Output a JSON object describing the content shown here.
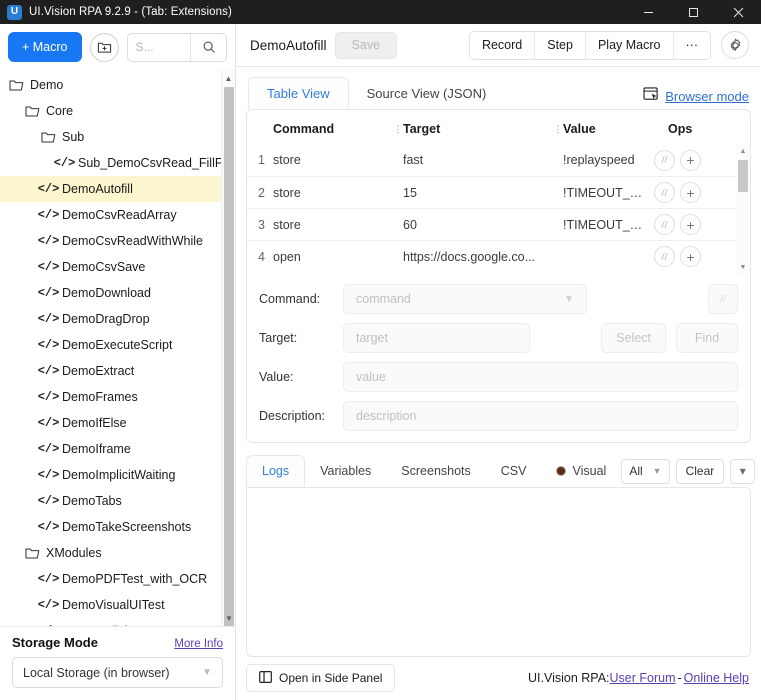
{
  "window": {
    "title": "UI.Vision RPA 9.2.9 - (Tab: Extensions)",
    "logo_letter": "U",
    "minimize_icon": "minimize-icon",
    "maximize_icon": "maximize-icon",
    "close_icon": "close-icon"
  },
  "sidebar": {
    "new_macro_label": "+ Macro",
    "new_folder_icon": "new-folder-icon",
    "search": {
      "value": "",
      "placeholder": "S..."
    },
    "search_icon": "search-icon",
    "tree": [
      {
        "label": "Demo",
        "type": "folder",
        "depth": 0,
        "selected": false
      },
      {
        "label": "Core",
        "type": "folder",
        "depth": 1,
        "selected": false
      },
      {
        "label": "Sub",
        "type": "folder",
        "depth": 2,
        "selected": false
      },
      {
        "label": "Sub_DemoCsvRead_FillFor",
        "type": "macro",
        "depth": 3,
        "selected": false
      },
      {
        "label": "DemoAutofill",
        "type": "macro",
        "depth": 2,
        "selected": true
      },
      {
        "label": "DemoCsvReadArray",
        "type": "macro",
        "depth": 2,
        "selected": false
      },
      {
        "label": "DemoCsvReadWithWhile",
        "type": "macro",
        "depth": 2,
        "selected": false
      },
      {
        "label": "DemoCsvSave",
        "type": "macro",
        "depth": 2,
        "selected": false
      },
      {
        "label": "DemoDownload",
        "type": "macro",
        "depth": 2,
        "selected": false
      },
      {
        "label": "DemoDragDrop",
        "type": "macro",
        "depth": 2,
        "selected": false
      },
      {
        "label": "DemoExecuteScript",
        "type": "macro",
        "depth": 2,
        "selected": false
      },
      {
        "label": "DemoExtract",
        "type": "macro",
        "depth": 2,
        "selected": false
      },
      {
        "label": "DemoFrames",
        "type": "macro",
        "depth": 2,
        "selected": false
      },
      {
        "label": "DemoIfElse",
        "type": "macro",
        "depth": 2,
        "selected": false
      },
      {
        "label": "DemoIframe",
        "type": "macro",
        "depth": 2,
        "selected": false
      },
      {
        "label": "DemoImplicitWaiting",
        "type": "macro",
        "depth": 2,
        "selected": false
      },
      {
        "label": "DemoTabs",
        "type": "macro",
        "depth": 2,
        "selected": false
      },
      {
        "label": "DemoTakeScreenshots",
        "type": "macro",
        "depth": 2,
        "selected": false
      },
      {
        "label": "XModules",
        "type": "folder",
        "depth": 1,
        "selected": false
      },
      {
        "label": "DemoPDFTest_with_OCR",
        "type": "macro",
        "depth": 2,
        "selected": false
      },
      {
        "label": "DemoVisualUITest",
        "type": "macro",
        "depth": 2,
        "selected": false
      },
      {
        "label": "DemoXClick",
        "type": "macro",
        "depth": 2,
        "selected": false
      }
    ],
    "storage": {
      "title": "Storage Mode",
      "more_info_label": "More Info",
      "selected": "Local Storage (in browser)"
    }
  },
  "toolbar": {
    "macro_name": "DemoAutofill",
    "save_label": "Save",
    "record_label": "Record",
    "step_label": "Step",
    "play_macro_label": "Play Macro",
    "more_label": "···",
    "gear_icon": "gear-icon"
  },
  "view_tabs": {
    "items": [
      {
        "label": "Table View",
        "active": true
      },
      {
        "label": "Source View (JSON)",
        "active": false
      }
    ],
    "browser_mode_label": "Browser mode",
    "browser_mode_icon": "browser-window-cursor-icon"
  },
  "table": {
    "columns": [
      "Command",
      "Target",
      "Value",
      "Ops"
    ],
    "rows": [
      {
        "index": "1",
        "command": "store",
        "target": "fast",
        "value": "!replayspeed"
      },
      {
        "index": "2",
        "command": "store",
        "target": "15",
        "value": "!TIMEOUT_WAIT"
      },
      {
        "index": "3",
        "command": "store",
        "target": "60",
        "value": "!TIMEOUT_PAGE..."
      },
      {
        "index": "4",
        "command": "open",
        "target": "https://docs.google.co...",
        "value": ""
      }
    ],
    "op_comment_label": "//",
    "op_add_label": "+"
  },
  "editor": {
    "command_label": "Command:",
    "command_placeholder": "command",
    "command_value": "",
    "target_label": "Target:",
    "target_placeholder": "target",
    "target_value": "",
    "value_label": "Value:",
    "value_placeholder": "value",
    "value_value": "",
    "description_label": "Description:",
    "description_placeholder": "description",
    "description_value": "",
    "select_label": "Select",
    "find_label": "Find",
    "comment_label": "//"
  },
  "logs": {
    "tabs": [
      {
        "label": "Logs",
        "active": true
      },
      {
        "label": "Variables",
        "active": false
      },
      {
        "label": "Screenshots",
        "active": false
      },
      {
        "label": "CSV",
        "active": false
      },
      {
        "label": "Visual",
        "active": false
      }
    ],
    "filter_selected": "All",
    "clear_label": "Clear",
    "expand_icon": "chevron-down-icon",
    "content": ""
  },
  "footer": {
    "side_panel_label": "Open in Side Panel",
    "side_panel_icon": "side-panel-icon",
    "brand": "UI.Vision RPA:",
    "user_forum_label": " User Forum",
    "separator": " - ",
    "online_help_label": " Online Help"
  },
  "colors": {
    "accent_blue": "#1877f2",
    "link_blue": "#2f6fd0",
    "visited_purple": "#5b3fb5",
    "selected_row": "#fbf6cd",
    "titlebar": "#1f1f1f",
    "visual_dot": "#5e2b18"
  }
}
